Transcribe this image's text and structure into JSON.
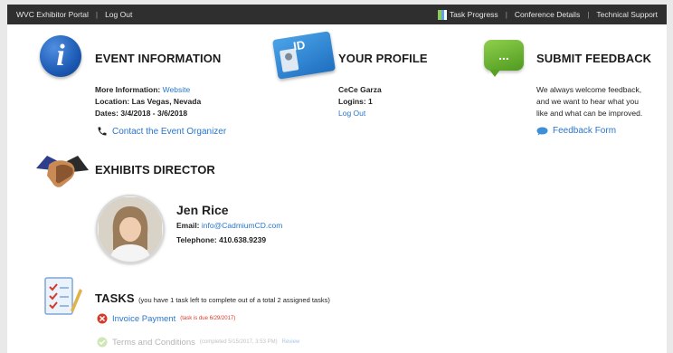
{
  "topbar": {
    "portal_name": "WVC Exhibitor Portal",
    "logout": "Log Out",
    "task_progress": "Task Progress",
    "conference_details": "Conference Details",
    "technical_support": "Technical Support",
    "separator": "|"
  },
  "event": {
    "icon_letter": "i",
    "title": "EVENT INFORMATION",
    "more_info_label": "More Information:",
    "more_info_link": "Website",
    "location_label": "Location:",
    "location_value": "Las Vegas, Nevada",
    "dates_label": "Dates:",
    "dates_value": "3/4/2018 - 3/6/2018",
    "contact_link": "Contact the Event Organizer"
  },
  "profile": {
    "card_text": "ID",
    "title": "YOUR PROFILE",
    "name": "CeCe Garza",
    "logins": "Logins: 1",
    "logout": "Log Out"
  },
  "feedback": {
    "bubble_text": "...",
    "title": "SUBMIT FEEDBACK",
    "line1": "We always welcome feedback,",
    "line2": "and we want to hear what you",
    "line3": "like and what can be improved.",
    "form_link": "Feedback Form"
  },
  "director": {
    "title": "EXHIBITS DIRECTOR",
    "name": "Jen Rice",
    "email_label": "Email:",
    "email": "info@CadmiumCD.com",
    "telephone": "Telephone: 410.638.9239"
  },
  "tasks": {
    "title": "TASKS",
    "summary": "(you have 1 task left to complete out of a total 2 assigned tasks)",
    "items": [
      {
        "label": "Invoice Payment",
        "note": "(task is due 6/29/2017)",
        "status": "overdue"
      },
      {
        "label": "Terms and Conditions",
        "note": "(completed 5/15/2017, 3:53 PM)",
        "extra": "Review",
        "status": "done"
      }
    ]
  },
  "colors": {
    "topbar": "#2f2f2f",
    "link": "#2a76c9",
    "overdue": "#d23a2a",
    "done": "#8fc95a",
    "progress_segments": [
      "#8fc95a",
      "#5aa6e0",
      "#ffffff"
    ]
  },
  "icons": [
    "progress-icon",
    "info-icon",
    "id-card-icon",
    "chat-bubble-icon",
    "phone-icon",
    "handshake-icon",
    "clipboard-icon",
    "overdue-icon",
    "check-icon",
    "feedback-bubble-icon"
  ]
}
